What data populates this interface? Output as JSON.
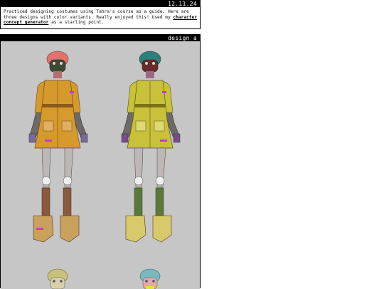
{
  "post1": {
    "date": "12.11.24",
    "text_before": "Practiced designing costumes using Tahra's course as a guide. Here are three designs with color variants. Really enjoyed this! Used my ",
    "link": "character concept generator",
    "text_after": " as a starting point."
  },
  "post2": {
    "title": "design a"
  },
  "colors": {
    "artwork_bg": "#c6c6c6",
    "variant_left_dress": "#d69a2c",
    "variant_right_dress": "#c9c13a",
    "variant_left_hair": "#e0736e",
    "variant_right_hair": "#2f7f78"
  }
}
